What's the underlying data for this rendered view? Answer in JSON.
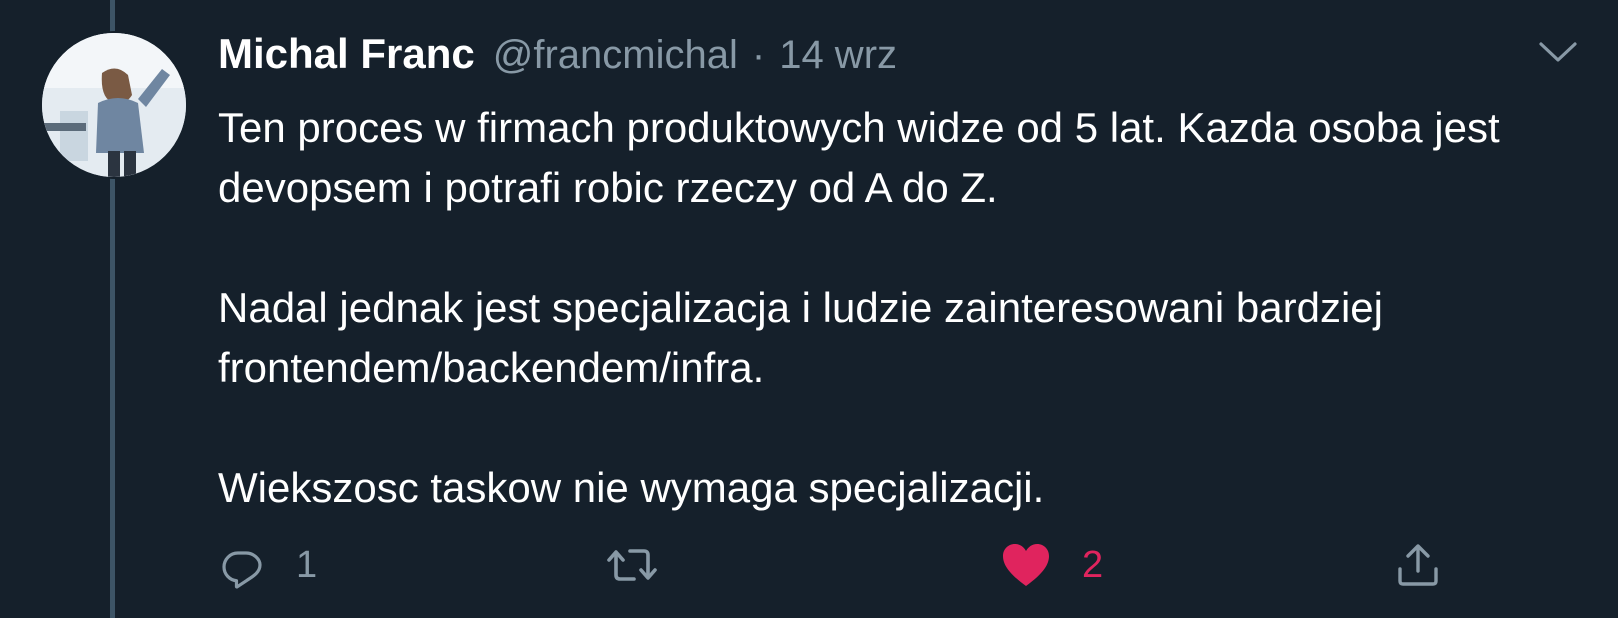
{
  "author": {
    "name": "Michal Franc",
    "handle": "@francmichal",
    "separator": "·",
    "date": "14 wrz"
  },
  "tweet": {
    "text": "Ten proces w firmach produktowych widze od 5 lat. Kazda osoba jest devopsem i potrafi robic rzeczy od A do Z.\n\nNadal jednak jest specjalizacja i ludzie zainteresowani bardziej frontendem/backendem/infra.\n\nWiekszosc taskow nie wymaga specjalizacji."
  },
  "actions": {
    "reply": {
      "icon": "reply-icon",
      "count": "1"
    },
    "retweet": {
      "icon": "retweet-icon",
      "count": ""
    },
    "like": {
      "icon": "heart-icon",
      "count": "2",
      "liked": true
    },
    "share": {
      "icon": "share-icon"
    }
  },
  "colors": {
    "background": "#15202b",
    "text": "#ffffff",
    "secondary": "#8899a6",
    "like": "#e0245e"
  }
}
